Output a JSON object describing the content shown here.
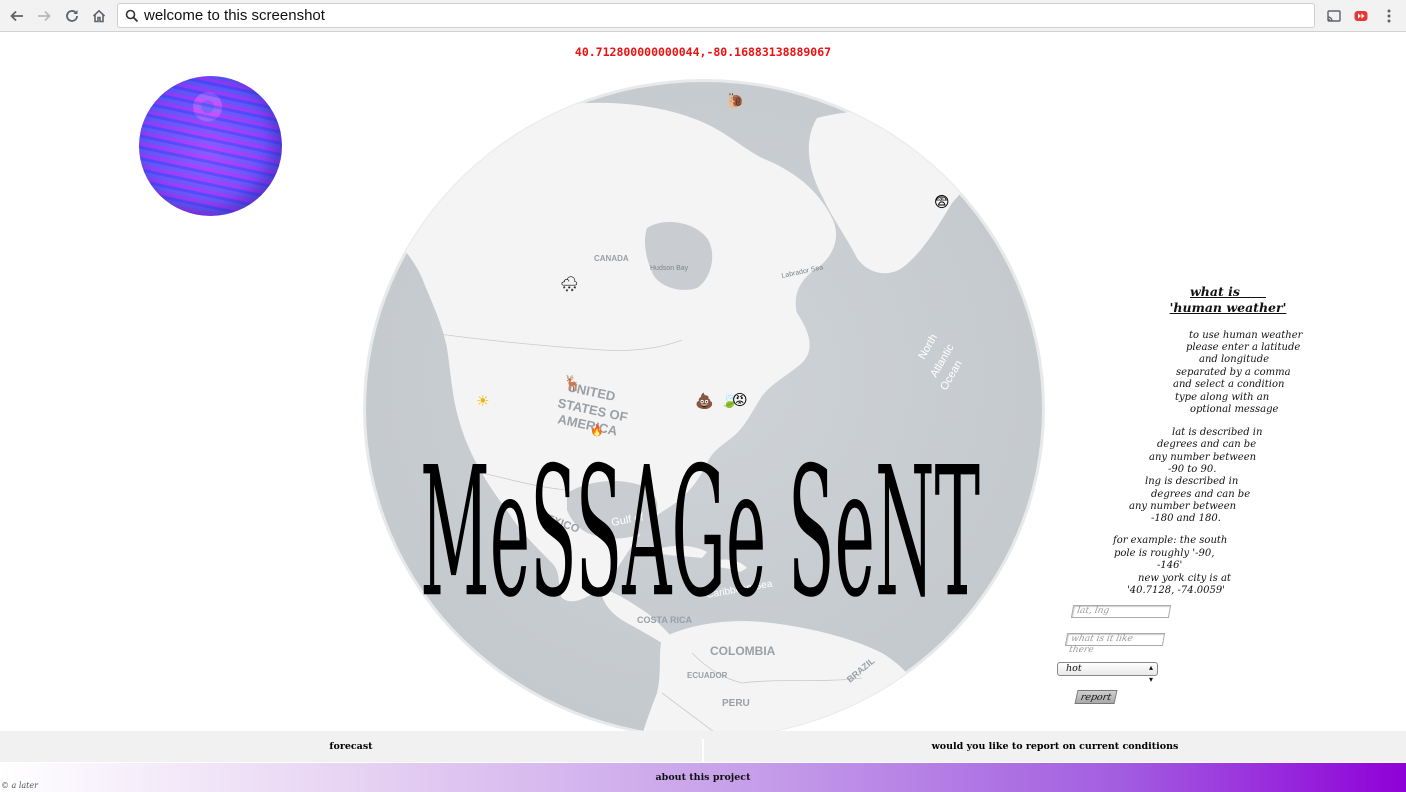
{
  "browser": {
    "url_text": "welcome to this screenshot",
    "icons": [
      "back-icon",
      "forward-icon",
      "reload-icon",
      "home-icon",
      "search-icon",
      "cast-icon",
      "extension-icon",
      "menu-icon"
    ]
  },
  "coordinates_display": "40.712800000000044,-80.16883138889067",
  "map_labels": {
    "canada": "CANADA",
    "hudson_bay": "Hudson Bay",
    "labrador_sea": "Labrador Sea",
    "usa_line1": "UNITED",
    "usa_line2": "STATES OF",
    "usa_line3": "AMERICA",
    "north_atlantic_1": "North",
    "north_atlantic_2": "Atlantic",
    "north_atlantic_3": "Ocean",
    "mexico": "MEXICO",
    "gulf": "Gulf of",
    "caribbean": "Caribbean Sea",
    "costa_rica": "COSTA RICA",
    "colombia": "COLOMBIA",
    "ecuador": "ECUADOR",
    "peru": "PERU",
    "brazil": "BRAZIL"
  },
  "markers": [
    {
      "emoji": "🐌",
      "name": "snail-marker"
    },
    {
      "emoji": "😨",
      "name": "fearful-face-marker"
    },
    {
      "emoji": "🌨",
      "name": "snow-cloud-marker"
    },
    {
      "emoji": "🦌",
      "name": "deer-marker"
    },
    {
      "emoji": "☀",
      "name": "sun-marker"
    },
    {
      "emoji": "💩",
      "name": "poop-marker"
    },
    {
      "emoji": "🍃",
      "name": "leaves-marker"
    },
    {
      "emoji": "😡",
      "name": "angry-face-marker"
    },
    {
      "emoji": "🔥",
      "name": "fire-marker"
    }
  ],
  "message_sent": "MeSSAGe SeNT",
  "info": {
    "title_line1": "what is      ",
    "title_line2": "'human weather'",
    "lines": [
      "to use human weather",
      "please enter a latitude",
      "and longitude",
      "separated by a comma",
      "and select a condition",
      "type along with an",
      "optional message",
      "",
      "lat is described in",
      "degrees and can be",
      "any number between",
      "-90 to 90.",
      "lng is described in",
      "degrees and can be",
      "any number between",
      "-180 and 180.",
      "",
      "for example: the south",
      "pole is roughly '-90,",
      "-146'",
      "new york city is at",
      "'40.7128, -74.0059'"
    ]
  },
  "form": {
    "latlng_placeholder": "lat, lng",
    "message_placeholder": "what is it like there",
    "condition_selected": "hot",
    "report_label": "report"
  },
  "footer": {
    "forecast_label": "forecast",
    "report_conditions_label": "would you like to report on current conditions",
    "about_label": "about this project",
    "credit": "© a later"
  },
  "colors": {
    "coordinate_text": "#e11111",
    "globe_ocean": "#c9cdd1",
    "globe_land": "#f4f4f4",
    "about_gradient_end": "#8f00d8"
  }
}
